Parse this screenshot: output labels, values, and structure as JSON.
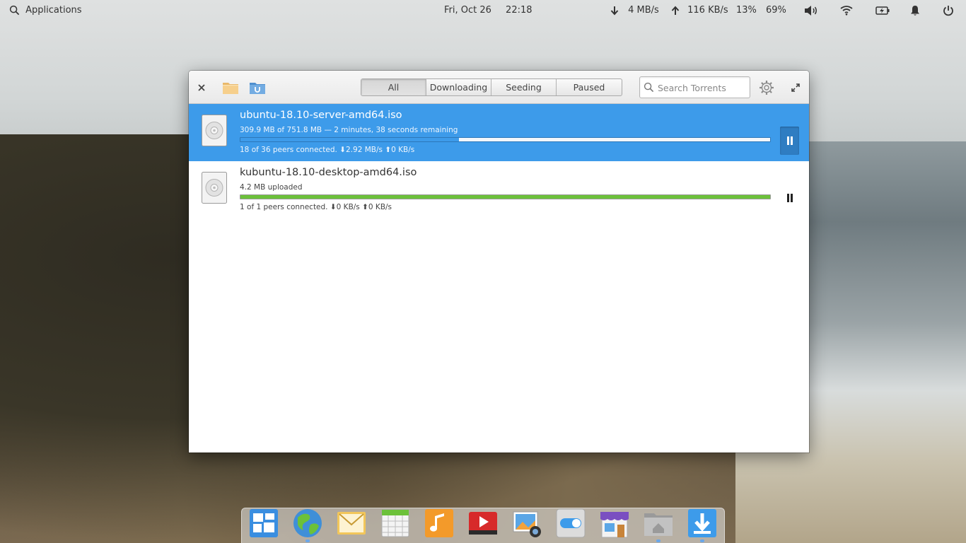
{
  "panel": {
    "applications_label": "Applications",
    "date": "Fri, Oct 26",
    "time": "22:18",
    "download_speed": "4 MB/s",
    "upload_speed": "116 KB/s",
    "cpu": "13%",
    "battery": "69%"
  },
  "window": {
    "tabs": [
      {
        "label": "All",
        "active": true
      },
      {
        "label": "Downloading",
        "active": false
      },
      {
        "label": "Seeding",
        "active": false
      },
      {
        "label": "Paused",
        "active": false
      }
    ],
    "search_placeholder": "Search Torrents",
    "torrents": [
      {
        "name": "ubuntu-18.10-server-amd64.iso",
        "status": "309.9 MB of 751.8 MB — 2 minutes, 38 seconds remaining",
        "progress": 0.412,
        "peers": "18 of 36 peers connected. ⬇2.92 MB/s ⬆0 KB/s",
        "selected": true,
        "bar_color": "#3d9bea"
      },
      {
        "name": "kubuntu-18.10-desktop-amd64.iso",
        "status": "4.2 MB uploaded",
        "progress": 1.0,
        "peers": "1 of 1 peers connected. ⬇0 KB/s ⬆0 KB/s",
        "selected": false,
        "bar_color": "#6cc13a"
      }
    ]
  },
  "dock": {
    "items": [
      {
        "icon": "multitasking-view-icon",
        "running": false
      },
      {
        "icon": "web-browser-icon",
        "running": true
      },
      {
        "icon": "mail-icon",
        "running": false
      },
      {
        "icon": "calendar-icon",
        "running": false
      },
      {
        "icon": "music-icon",
        "running": false
      },
      {
        "icon": "videos-icon",
        "running": false
      },
      {
        "icon": "photos-icon",
        "running": false
      },
      {
        "icon": "system-settings-icon",
        "running": false
      },
      {
        "icon": "appcenter-icon",
        "running": false
      },
      {
        "icon": "files-icon",
        "running": true
      },
      {
        "icon": "torrent-downloader-icon",
        "running": true
      }
    ]
  },
  "colors": {
    "accent": "#3d9bea",
    "complete": "#6cc13a"
  }
}
